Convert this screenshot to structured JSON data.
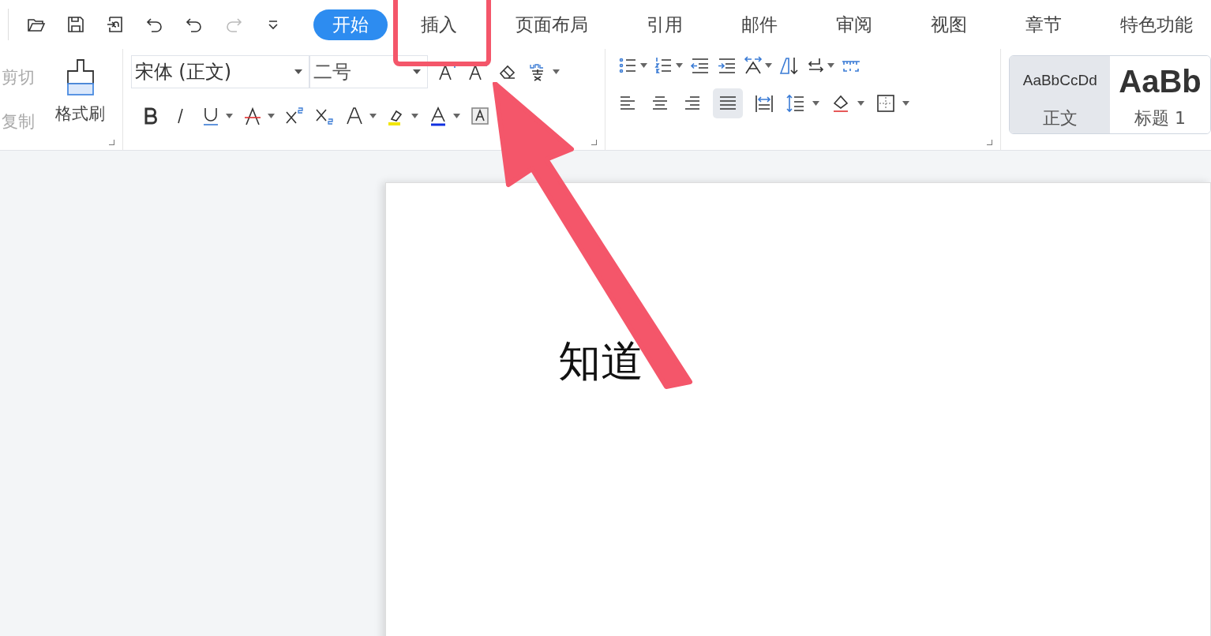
{
  "tabs": [
    {
      "label": "开始",
      "selected": true
    },
    {
      "label": "插入",
      "selected": false
    },
    {
      "label": "页面布局",
      "selected": false
    },
    {
      "label": "引用",
      "selected": false
    },
    {
      "label": "邮件",
      "selected": false
    },
    {
      "label": "审阅",
      "selected": false
    },
    {
      "label": "视图",
      "selected": false
    },
    {
      "label": "章节",
      "selected": false
    },
    {
      "label": "特色功能",
      "selected": false
    }
  ],
  "clipboard": {
    "cut": {
      "label": "剪切",
      "disabled": true
    },
    "copy": {
      "label": "复制",
      "disabled": true
    },
    "format_painter": {
      "label": "格式刷"
    }
  },
  "font": {
    "family": "宋体 (正文)",
    "size": "二号"
  },
  "styles": [
    {
      "sample": "AaBbCcDd",
      "name": "正文",
      "selected": true
    },
    {
      "sample": "AaBb",
      "name": "标题 1",
      "selected": false
    }
  ],
  "document": {
    "text": "知道"
  }
}
